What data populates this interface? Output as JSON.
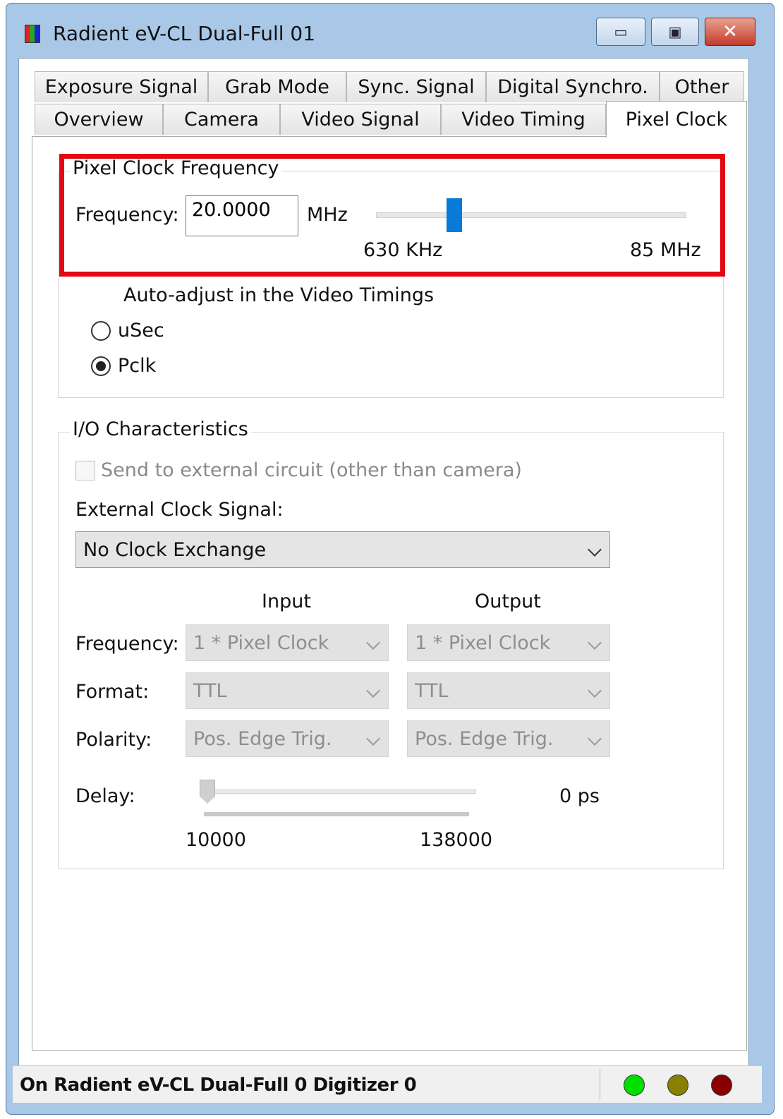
{
  "window": {
    "title": "Radient eV-CL Dual-Full 01",
    "minimize_glyph": "▭",
    "maximize_glyph": "▣",
    "close_glyph": "✕"
  },
  "tabs": {
    "row1": [
      "Exposure Signal",
      "Grab Mode",
      "Sync. Signal",
      "Digital Synchro.",
      "Other"
    ],
    "row2": [
      "Overview",
      "Camera",
      "Video Signal",
      "Video Timing",
      "Pixel Clock"
    ],
    "active": "Pixel Clock"
  },
  "pixel_clock_frequency": {
    "group_title": "Pixel Clock Frequency",
    "frequency_label": "Frequency:",
    "frequency_value": "20.0000",
    "unit": "MHz",
    "slider_min_label": "630 KHz",
    "slider_max_label": "85 MHz",
    "slider_value_fraction": 0.24,
    "auto_adjust_label": "Auto-adjust in the Video Timings",
    "radio_usec": "uSec",
    "radio_pclk": "Pclk",
    "selected": "Pclk"
  },
  "io": {
    "group_title": "I/O Characteristics",
    "send_external_label": "Send to external circuit (other than camera)",
    "external_clock_label": "External Clock Signal:",
    "external_clock_value": "No Clock Exchange",
    "input_header": "Input",
    "output_header": "Output",
    "frequency_label": "Frequency:",
    "format_label": "Format:",
    "polarity_label": "Polarity:",
    "input_frequency": "1 * Pixel Clock",
    "output_frequency": "1 * Pixel Clock",
    "input_format": "TTL",
    "output_format": "TTL",
    "input_polarity": "Pos. Edge Trig.",
    "output_polarity": "Pos. Edge Trig.",
    "delay_label": "Delay:",
    "delay_value": "0 ps",
    "delay_min": "10000",
    "delay_max": "138000",
    "delay_fraction": 0.0
  },
  "status": {
    "text": "On Radient eV-CL Dual-Full 0 Digitizer 0",
    "leds": [
      "#00e000",
      "#8a8000",
      "#8a0000"
    ]
  },
  "highlight_color": "#e30613"
}
